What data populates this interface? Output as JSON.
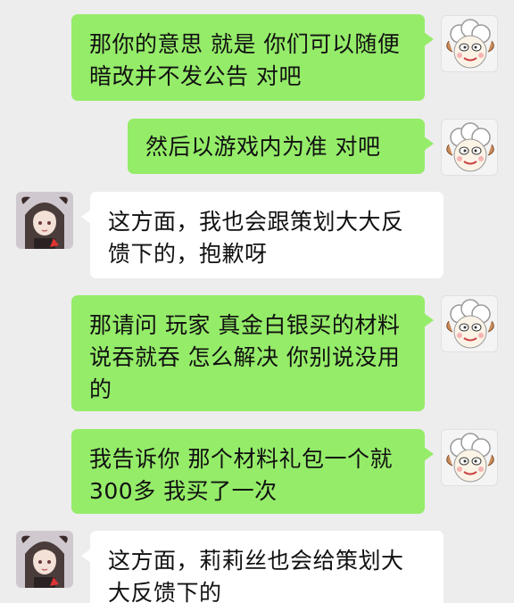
{
  "messages": [
    {
      "side": "me",
      "text": "那你的意思 就是 你们可以随便暗改并不发公告 对吧",
      "avatar": "sheep-avatar-icon"
    },
    {
      "side": "me",
      "text": "然后以游戏内为准  对吧",
      "avatar": "sheep-avatar-icon"
    },
    {
      "side": "other",
      "text": "这方面，我也会跟策划大大反馈下的，抱歉呀",
      "avatar": "girl-avatar-icon"
    },
    {
      "side": "me",
      "text": "那请问 玩家 真金白银买的材料 说吞就吞  怎么解决 你别说没用的",
      "avatar": "sheep-avatar-icon"
    },
    {
      "side": "me",
      "text": "我告诉你 那个材料礼包一个就300多  我买了一次",
      "avatar": "sheep-avatar-icon"
    },
    {
      "side": "other",
      "text": "这方面，莉莉丝也会给策划大大反馈下的",
      "avatar": "girl-avatar-icon"
    }
  ],
  "colors": {
    "background": "#ededed",
    "me_bubble": "#95ec69",
    "other_bubble": "#ffffff"
  }
}
